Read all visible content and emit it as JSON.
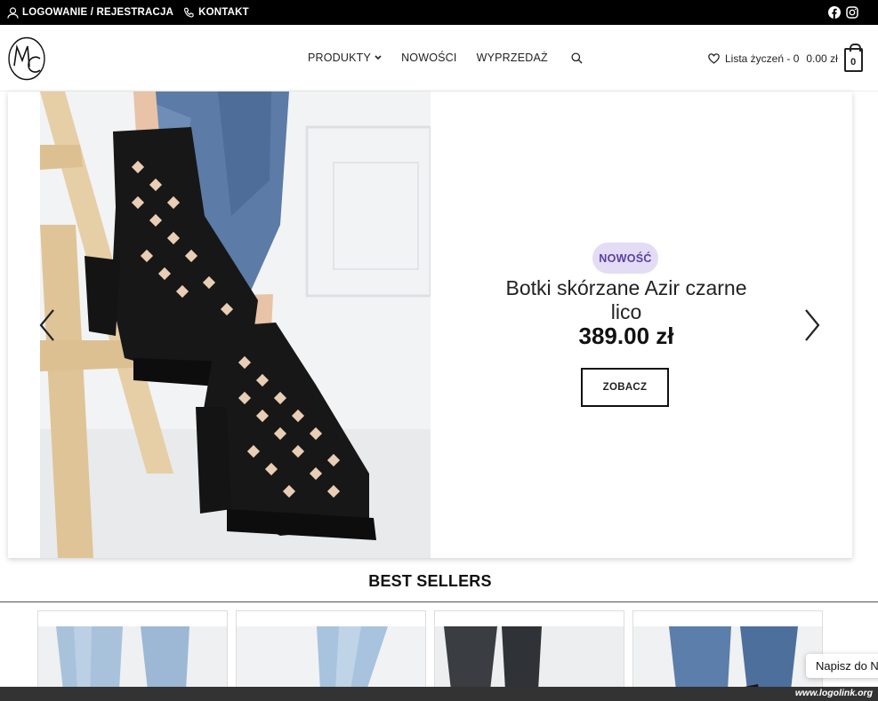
{
  "topbar": {
    "login_label": "LOGOWANIE / REJESTRACJA",
    "contact_label": "KONTAKT",
    "social": [
      "facebook-icon",
      "instagram-icon"
    ]
  },
  "header": {
    "logo_text": "MC",
    "nav": [
      {
        "label": "PRODUKTY",
        "has_dropdown": true
      },
      {
        "label": "NOWOŚCI"
      },
      {
        "label": "WYPRZEDAŻ"
      }
    ],
    "wishlist_label": "Lista życzeń - 0",
    "cart_total": "0.00 zł",
    "cart_count": "0"
  },
  "hero": {
    "badge": "NOWOŚĆ",
    "title": "Botki skórzane Azir czarne lico",
    "price": "389.00 zł",
    "button_label": "ZOBACZ"
  },
  "best_sellers": {
    "title": "BEST SELLERS",
    "cards": [
      {
        "image": "light-jeans"
      },
      {
        "image": "light-jeans"
      },
      {
        "image": "black-jeans"
      },
      {
        "image": "blue-jeans"
      }
    ]
  },
  "chat": {
    "label": "Napisz do N"
  },
  "watermark": "www.logolink.org",
  "colors": {
    "topbar_bg": "#000000",
    "badge_bg": "#e4dcf5",
    "badge_text": "#5a3fa0",
    "footer_bar": "#333333"
  }
}
